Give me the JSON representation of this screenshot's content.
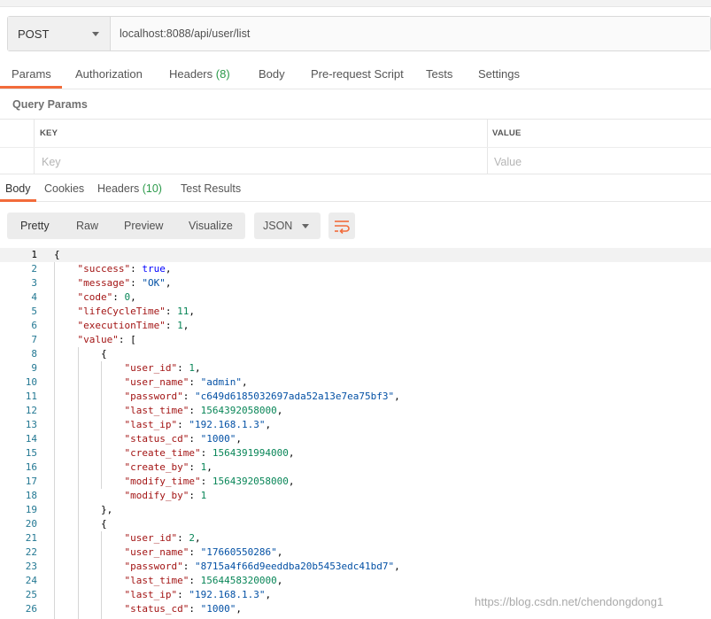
{
  "request": {
    "method": "POST",
    "url": "localhost:8088/api/user/list"
  },
  "request_tabs": [
    {
      "label": "Params",
      "count": ""
    },
    {
      "label": "Authorization",
      "count": ""
    },
    {
      "label": "Headers",
      "count": "(8)"
    },
    {
      "label": "Body",
      "count": ""
    },
    {
      "label": "Pre-request Script",
      "count": ""
    },
    {
      "label": "Tests",
      "count": ""
    },
    {
      "label": "Settings",
      "count": ""
    }
  ],
  "query_params": {
    "title": "Query Params",
    "col_key": "KEY",
    "col_value": "VALUE",
    "key_placeholder": "Key",
    "value_placeholder": "Value"
  },
  "response_tabs": [
    {
      "label": "Body",
      "count": ""
    },
    {
      "label": "Cookies",
      "count": ""
    },
    {
      "label": "Headers",
      "count": "(10)"
    },
    {
      "label": "Test Results",
      "count": ""
    }
  ],
  "view_modes": [
    "Pretty",
    "Raw",
    "Preview",
    "Visualize"
  ],
  "format": "JSON",
  "code_lines": [
    [
      [
        "p",
        "{"
      ]
    ],
    [
      [
        "p",
        "    "
      ],
      [
        "k",
        "\"success\""
      ],
      [
        "p",
        ": "
      ],
      [
        "b",
        "true"
      ],
      [
        "p",
        ","
      ]
    ],
    [
      [
        "p",
        "    "
      ],
      [
        "k",
        "\"message\""
      ],
      [
        "p",
        ": "
      ],
      [
        "s",
        "\"OK\""
      ],
      [
        "p",
        ","
      ]
    ],
    [
      [
        "p",
        "    "
      ],
      [
        "k",
        "\"code\""
      ],
      [
        "p",
        ": "
      ],
      [
        "n",
        "0"
      ],
      [
        "p",
        ","
      ]
    ],
    [
      [
        "p",
        "    "
      ],
      [
        "k",
        "\"lifeCycleTime\""
      ],
      [
        "p",
        ": "
      ],
      [
        "n",
        "11"
      ],
      [
        "p",
        ","
      ]
    ],
    [
      [
        "p",
        "    "
      ],
      [
        "k",
        "\"executionTime\""
      ],
      [
        "p",
        ": "
      ],
      [
        "n",
        "1"
      ],
      [
        "p",
        ","
      ]
    ],
    [
      [
        "p",
        "    "
      ],
      [
        "k",
        "\"value\""
      ],
      [
        "p",
        ": ["
      ]
    ],
    [
      [
        "p",
        "        {"
      ]
    ],
    [
      [
        "p",
        "            "
      ],
      [
        "k",
        "\"user_id\""
      ],
      [
        "p",
        ": "
      ],
      [
        "n",
        "1"
      ],
      [
        "p",
        ","
      ]
    ],
    [
      [
        "p",
        "            "
      ],
      [
        "k",
        "\"user_name\""
      ],
      [
        "p",
        ": "
      ],
      [
        "s",
        "\"admin\""
      ],
      [
        "p",
        ","
      ]
    ],
    [
      [
        "p",
        "            "
      ],
      [
        "k",
        "\"password\""
      ],
      [
        "p",
        ": "
      ],
      [
        "s",
        "\"c649d6185032697ada52a13e7ea75bf3\""
      ],
      [
        "p",
        ","
      ]
    ],
    [
      [
        "p",
        "            "
      ],
      [
        "k",
        "\"last_time\""
      ],
      [
        "p",
        ": "
      ],
      [
        "n",
        "1564392058000"
      ],
      [
        "p",
        ","
      ]
    ],
    [
      [
        "p",
        "            "
      ],
      [
        "k",
        "\"last_ip\""
      ],
      [
        "p",
        ": "
      ],
      [
        "s",
        "\"192.168.1.3\""
      ],
      [
        "p",
        ","
      ]
    ],
    [
      [
        "p",
        "            "
      ],
      [
        "k",
        "\"status_cd\""
      ],
      [
        "p",
        ": "
      ],
      [
        "s",
        "\"1000\""
      ],
      [
        "p",
        ","
      ]
    ],
    [
      [
        "p",
        "            "
      ],
      [
        "k",
        "\"create_time\""
      ],
      [
        "p",
        ": "
      ],
      [
        "n",
        "1564391994000"
      ],
      [
        "p",
        ","
      ]
    ],
    [
      [
        "p",
        "            "
      ],
      [
        "k",
        "\"create_by\""
      ],
      [
        "p",
        ": "
      ],
      [
        "n",
        "1"
      ],
      [
        "p",
        ","
      ]
    ],
    [
      [
        "p",
        "            "
      ],
      [
        "k",
        "\"modify_time\""
      ],
      [
        "p",
        ": "
      ],
      [
        "n",
        "1564392058000"
      ],
      [
        "p",
        ","
      ]
    ],
    [
      [
        "p",
        "            "
      ],
      [
        "k",
        "\"modify_by\""
      ],
      [
        "p",
        ": "
      ],
      [
        "n",
        "1"
      ]
    ],
    [
      [
        "p",
        "        },"
      ]
    ],
    [
      [
        "p",
        "        {"
      ]
    ],
    [
      [
        "p",
        "            "
      ],
      [
        "k",
        "\"user_id\""
      ],
      [
        "p",
        ": "
      ],
      [
        "n",
        "2"
      ],
      [
        "p",
        ","
      ]
    ],
    [
      [
        "p",
        "            "
      ],
      [
        "k",
        "\"user_name\""
      ],
      [
        "p",
        ": "
      ],
      [
        "s",
        "\"17660550286\""
      ],
      [
        "p",
        ","
      ]
    ],
    [
      [
        "p",
        "            "
      ],
      [
        "k",
        "\"password\""
      ],
      [
        "p",
        ": "
      ],
      [
        "s",
        "\"8715a4f66d9eeddba20b5453edc41bd7\""
      ],
      [
        "p",
        ","
      ]
    ],
    [
      [
        "p",
        "            "
      ],
      [
        "k",
        "\"last_time\""
      ],
      [
        "p",
        ": "
      ],
      [
        "n",
        "1564458320000"
      ],
      [
        "p",
        ","
      ]
    ],
    [
      [
        "p",
        "            "
      ],
      [
        "k",
        "\"last_ip\""
      ],
      [
        "p",
        ": "
      ],
      [
        "s",
        "\"192.168.1.3\""
      ],
      [
        "p",
        ","
      ]
    ],
    [
      [
        "p",
        "            "
      ],
      [
        "k",
        "\"status_cd\""
      ],
      [
        "p",
        ": "
      ],
      [
        "s",
        "\"1000\""
      ],
      [
        "p",
        ","
      ]
    ]
  ],
  "watermark": "https://blog.csdn.net/chendongdong1",
  "colors": {
    "accent": "#f26b3a",
    "count_green": "#2c9a4a",
    "json_key": "#a31515",
    "json_string": "#0451a5",
    "json_number": "#098658",
    "json_bool": "#0000ff",
    "line_number": "#237893"
  },
  "icons": {
    "method_dropdown": "chevron-down-icon",
    "format_dropdown": "chevron-down-icon",
    "wrap": "wrap-lines-icon"
  }
}
